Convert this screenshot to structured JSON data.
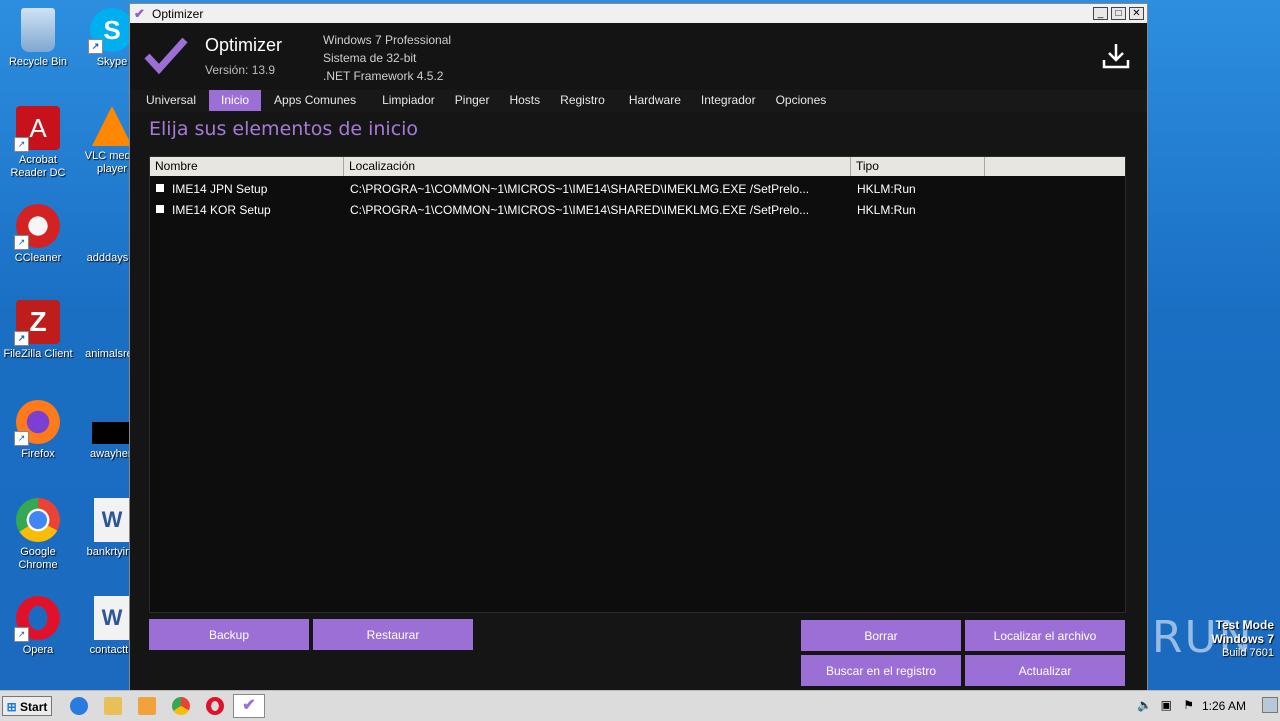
{
  "desktop": {
    "icons": [
      {
        "label": "Recycle Bin"
      },
      {
        "label": "Acrobat Reader DC"
      },
      {
        "label": "CCleaner"
      },
      {
        "label": "FileZilla Client"
      },
      {
        "label": "Firefox"
      },
      {
        "label": "Google Chrome"
      },
      {
        "label": "Opera"
      },
      {
        "label": "Skype"
      },
      {
        "label": "VLC media player"
      },
      {
        "label": "adddays.p"
      },
      {
        "label": "animalsreg"
      },
      {
        "label": "awayher."
      },
      {
        "label": "bankrtying"
      },
      {
        "label": "contactth"
      }
    ],
    "watermark": {
      "line1": "Test Mode",
      "line2": "Windows 7",
      "line3": "Build 7601"
    },
    "anyrun": "ANY RUN"
  },
  "window": {
    "title": "Optimizer",
    "buttons": {
      "minimize": "_",
      "maximize": "□",
      "close": "✕"
    }
  },
  "header": {
    "app_name": "Optimizer",
    "version": "Versión: 13.9",
    "os": "Windows 7 Professional",
    "arch": "Sistema de 32-bit",
    "framework": ".NET Framework 4.5.2"
  },
  "tabs": [
    {
      "label": "Universal"
    },
    {
      "label": "Inicio"
    },
    {
      "label": "Apps Comunes"
    },
    {
      "label": "Limpiador"
    },
    {
      "label": "Pinger"
    },
    {
      "label": "Hosts"
    },
    {
      "label": "Registro"
    },
    {
      "label": "Hardware"
    },
    {
      "label": "Integrador"
    },
    {
      "label": "Opciones"
    }
  ],
  "startup": {
    "title": "Elija sus elementos de inicio",
    "columns": {
      "name": "Nombre",
      "location": "Localización",
      "type": "Tipo"
    },
    "rows": [
      {
        "name": "IME14 JPN Setup",
        "location": "C:\\PROGRA~1\\COMMON~1\\MICROS~1\\IME14\\SHARED\\IMEKLMG.EXE /SetPrelo...",
        "type": "HKLM:Run"
      },
      {
        "name": "IME14 KOR Setup",
        "location": "C:\\PROGRA~1\\COMMON~1\\MICROS~1\\IME14\\SHARED\\IMEKLMG.EXE /SetPrelo...",
        "type": "HKLM:Run"
      }
    ],
    "buttons": {
      "backup": "Backup",
      "restore": "Restaurar",
      "delete": "Borrar",
      "locate_file": "Localizar el archivo",
      "search_registry": "Buscar en el registro",
      "refresh": "Actualizar"
    }
  },
  "taskbar": {
    "start": "Start",
    "clock": "1:26 AM"
  },
  "colors": {
    "accent": "#9b6fd6",
    "background": "#151515"
  }
}
